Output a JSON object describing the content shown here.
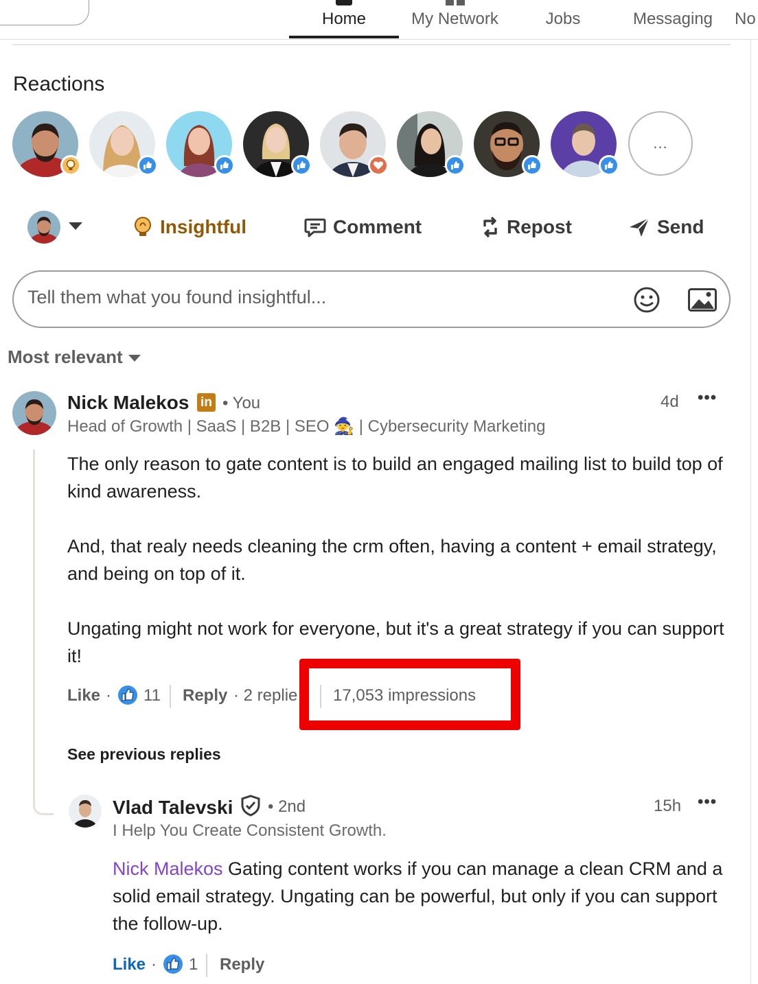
{
  "nav": {
    "items": [
      {
        "label": "Home",
        "icon": "home-icon",
        "active": true
      },
      {
        "label": "My Network",
        "icon": "network-icon"
      },
      {
        "label": "Jobs",
        "icon": "jobs-icon"
      },
      {
        "label": "Messaging",
        "icon": "messaging-icon"
      },
      {
        "label": "No",
        "icon": "notifications-icon"
      }
    ]
  },
  "reactions": {
    "title": "Reactions",
    "people": [
      {
        "reaction": "insightful"
      },
      {
        "reaction": "like"
      },
      {
        "reaction": "like"
      },
      {
        "reaction": "like"
      },
      {
        "reaction": "love"
      },
      {
        "reaction": "like"
      },
      {
        "reaction": "like"
      },
      {
        "reaction": "like"
      }
    ],
    "more_label": "..."
  },
  "actions": {
    "insightful": "Insightful",
    "comment": "Comment",
    "repost": "Repost",
    "send": "Send"
  },
  "comment_box": {
    "placeholder": "Tell them what you found insightful..."
  },
  "sort": {
    "label": "Most relevant"
  },
  "comment": {
    "author": "Nick Malekos",
    "badge": "in",
    "relation": "• You",
    "time": "4d",
    "more": "•••",
    "headline": "Head of Growth | SaaS | B2B | SEO 🧙 | Cybersecurity Marketing",
    "paragraphs": [
      "The only reason to gate content is to build an engaged mailing list to build top of kind awareness.",
      "And, that realy needs cleaning the crm often, having a content + email strategy, and being on top of it.",
      "Ungating might not work for everyone, but it's a great strategy if you can support it!"
    ],
    "footer": {
      "like": "Like",
      "dot": "·",
      "like_count": "11",
      "reply": "Reply",
      "replies": "· 2 replie",
      "impressions": "17,053 impressions"
    },
    "see_previous": "See previous replies"
  },
  "reply": {
    "author": "Vlad Talevski",
    "relation": "• 2nd",
    "time": "15h",
    "more": "•••",
    "headline": "I Help You Create Consistent Growth.",
    "mention": "Nick Malekos",
    "text": " Gating content works if you can manage a clean CRM and a solid email strategy. Ungating can be powerful, but only if you can support the follow-up.",
    "footer": {
      "like": "Like",
      "dot": "·",
      "like_count": "1",
      "reply": "Reply"
    }
  },
  "colors": {
    "insightful": "#915907",
    "like_blue": "#378fe9",
    "link_blue": "#0a66c2",
    "mention_purple": "#8344cc",
    "highlight_red": "#ee0000",
    "premium_gold": "#c37d16"
  }
}
